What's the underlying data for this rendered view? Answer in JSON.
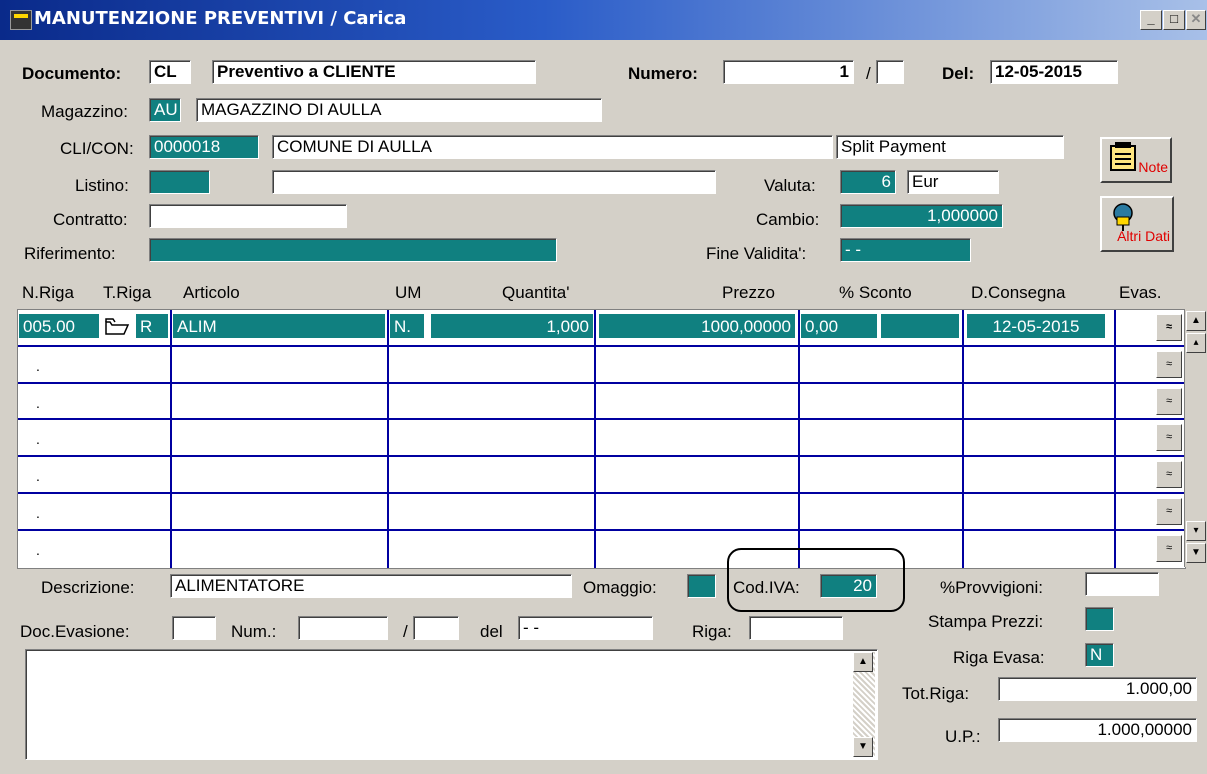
{
  "window": {
    "title": "MANUTENZIONE PREVENTIVI / Carica",
    "minimize": "_",
    "maximize": "□",
    "close": "✕"
  },
  "header": {
    "documento_label": "Documento:",
    "documento_code": "CL",
    "documento_desc": "Preventivo a CLIENTE",
    "numero_label": "Numero:",
    "numero_value": "1",
    "numero_sep": "/",
    "numero_suffix": "",
    "del_label": "Del:",
    "del_value": "12-05-2015",
    "magazzino_label": "Magazzino:",
    "magazzino_code": "AU",
    "magazzino_desc": "MAGAZZINO DI AULLA",
    "clicon_label": "CLI/CON:",
    "clicon_code": "0000018",
    "clicon_desc": "COMUNE DI AULLA",
    "split_payment": "Split Payment",
    "listino_label": "Listino:",
    "listino_code": "",
    "listino_desc": "",
    "valuta_label": "Valuta:",
    "valuta_code": "6",
    "valuta_desc": "Eur",
    "contratto_label": "Contratto:",
    "contratto_value": "",
    "cambio_label": "Cambio:",
    "cambio_value": "1,000000",
    "riferimento_label": "Riferimento:",
    "riferimento_value": "",
    "fine_validita_label": "Fine Validita':",
    "fine_validita_value": "- -"
  },
  "buttons": {
    "note_label": "Note",
    "note_icon": "notepad-icon",
    "altri_dati_label": "Altri Dati",
    "altri_dati_icon": "pushpin-icon"
  },
  "grid": {
    "columns": [
      "N.Riga",
      "T.Riga",
      "Articolo",
      "UM",
      "Quantita'",
      "Prezzo",
      "% Sconto",
      "D.Consegna",
      "Evas."
    ],
    "rows": [
      {
        "nriga": "005.00",
        "triga": "R",
        "articolo": "ALIM",
        "um": "N.",
        "quantita": "1,000",
        "prezzo": "1000,00000",
        "sconto": "0,00",
        "consegna": "12-05-2015",
        "evas_icon": "evasion-icon"
      },
      {
        "nriga": "."
      },
      {
        "nriga": "."
      },
      {
        "nriga": "."
      },
      {
        "nriga": "."
      },
      {
        "nriga": "."
      },
      {
        "nriga": "."
      }
    ],
    "evas_btn_text": "≈"
  },
  "footer": {
    "descrizione_label": "Descrizione:",
    "descrizione_value": "ALIMENTATORE",
    "omaggio_label": "Omaggio:",
    "omaggio_value": "",
    "codiva_label": "Cod.IVA:",
    "codiva_value": "20",
    "provvigioni_label": "%Provvigioni:",
    "provvigioni_value": "",
    "doc_evasione_label": "Doc.Evasione:",
    "doc_evasione_value": "",
    "num_label": "Num.:",
    "num_value": "",
    "num_sep": "/",
    "num_suffix": "",
    "del_label": "del",
    "del_value": "- -",
    "riga_label": "Riga:",
    "riga_value": "",
    "stampa_prezzi_label": "Stampa Prezzi:",
    "stampa_prezzi_value": "",
    "riga_evasa_label": "Riga Evasa:",
    "riga_evasa_value": "N",
    "tot_riga_label": "Tot.Riga:",
    "tot_riga_value": "1.000,00",
    "up_label": "U.P.:",
    "up_value": "1.000,00000",
    "memo_text": ""
  },
  "colors": {
    "teal": "#108080",
    "grid_lines": "#0000a0",
    "window_bg": "#d4d0c8"
  }
}
